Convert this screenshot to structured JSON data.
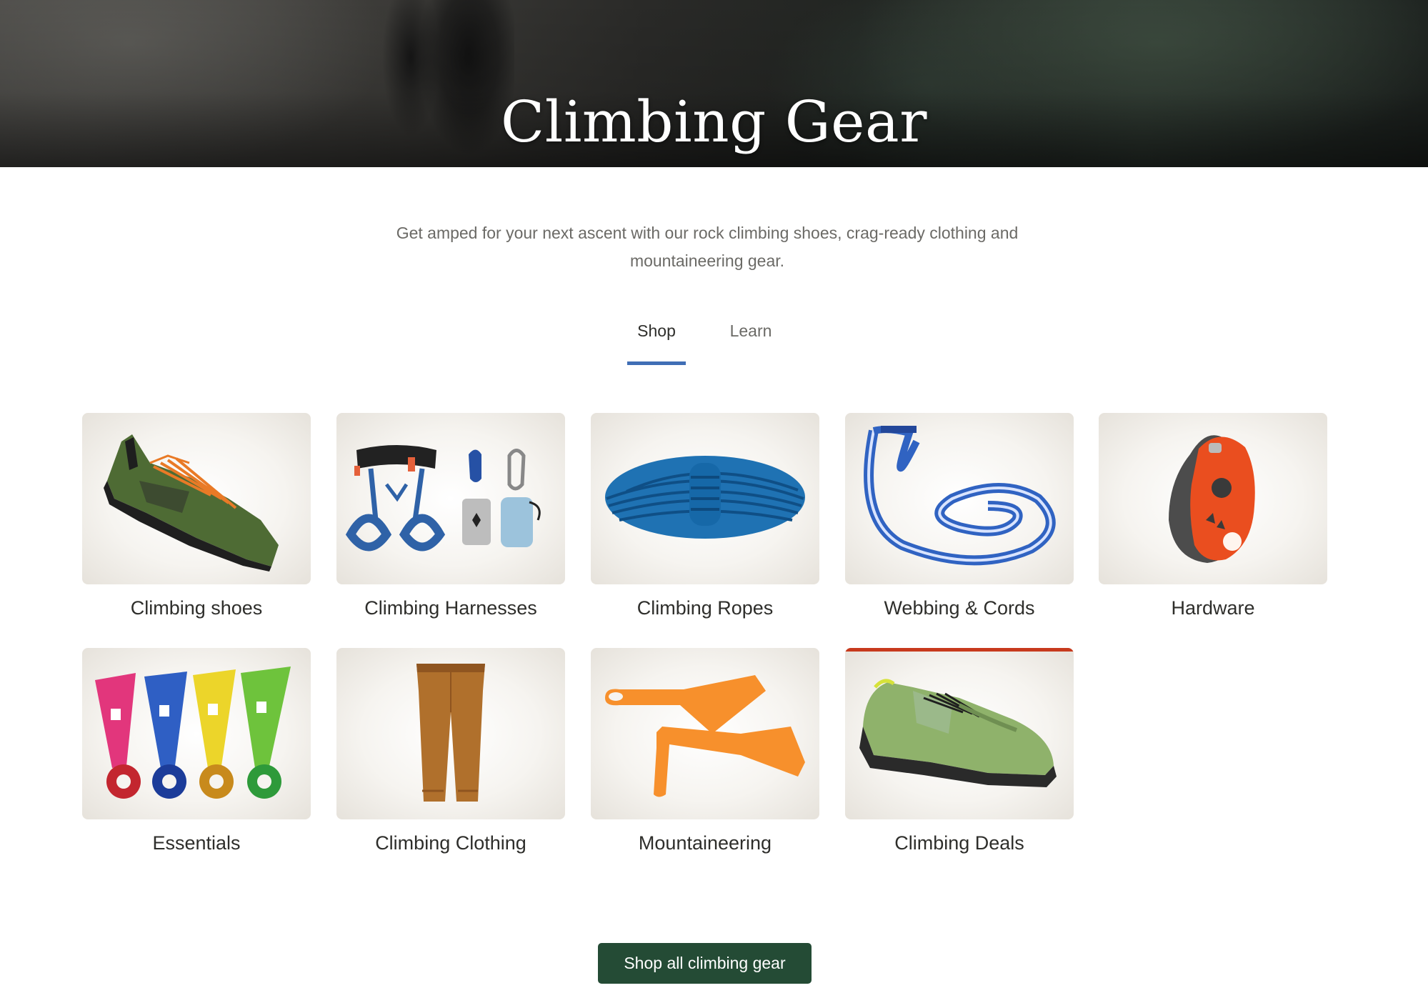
{
  "hero": {
    "title": "Climbing Gear"
  },
  "intro": {
    "text": "Get amped for your next ascent with our rock climbing shoes, crag-ready clothing and mountaineering gear."
  },
  "tabs": [
    {
      "label": "Shop",
      "active": true
    },
    {
      "label": "Learn",
      "active": false
    }
  ],
  "categories": [
    {
      "label": "Climbing shoes",
      "icon": "climbing-shoe-icon"
    },
    {
      "label": "Climbing Harnesses",
      "icon": "harness-icon"
    },
    {
      "label": "Climbing Ropes",
      "icon": "rope-icon"
    },
    {
      "label": "Webbing & Cords",
      "icon": "webbing-icon"
    },
    {
      "label": "Hardware",
      "icon": "belay-device-icon"
    },
    {
      "label": "Essentials",
      "icon": "finger-tape-icon"
    },
    {
      "label": "Climbing Clothing",
      "icon": "pants-icon"
    },
    {
      "label": "Mountaineering",
      "icon": "snow-picket-icon"
    },
    {
      "label": "Climbing Deals",
      "icon": "deal-shoe-icon"
    }
  ],
  "cta": {
    "label": "Shop all climbing gear"
  },
  "colors": {
    "accent": "#406eb5",
    "cta_bg": "#244b35",
    "deal_bar": "#c73a1d"
  }
}
